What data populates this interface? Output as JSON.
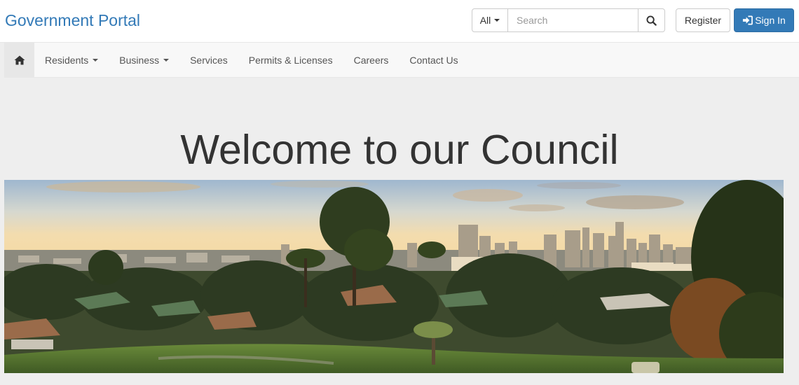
{
  "header": {
    "brand": "Government Portal",
    "search": {
      "scope": "All",
      "placeholder": "Search",
      "value": "",
      "icon": "search-icon"
    },
    "register_label": "Register",
    "signin_label": "Sign In",
    "signin_icon": "sign-in-icon"
  },
  "nav": {
    "home_icon": "home-icon",
    "items": [
      {
        "label": "Residents",
        "dropdown": true
      },
      {
        "label": "Business",
        "dropdown": true
      },
      {
        "label": "Services",
        "dropdown": false
      },
      {
        "label": "Permits & Licenses",
        "dropdown": false
      },
      {
        "label": "Careers",
        "dropdown": false
      },
      {
        "label": "Contact Us",
        "dropdown": false
      }
    ]
  },
  "hero": {
    "title": "Welcome to our Council"
  },
  "colors": {
    "brand": "#337ab7",
    "primary_button": "#337ab7",
    "page_background": "#eeeeee",
    "nav_background": "#f8f8f8"
  }
}
